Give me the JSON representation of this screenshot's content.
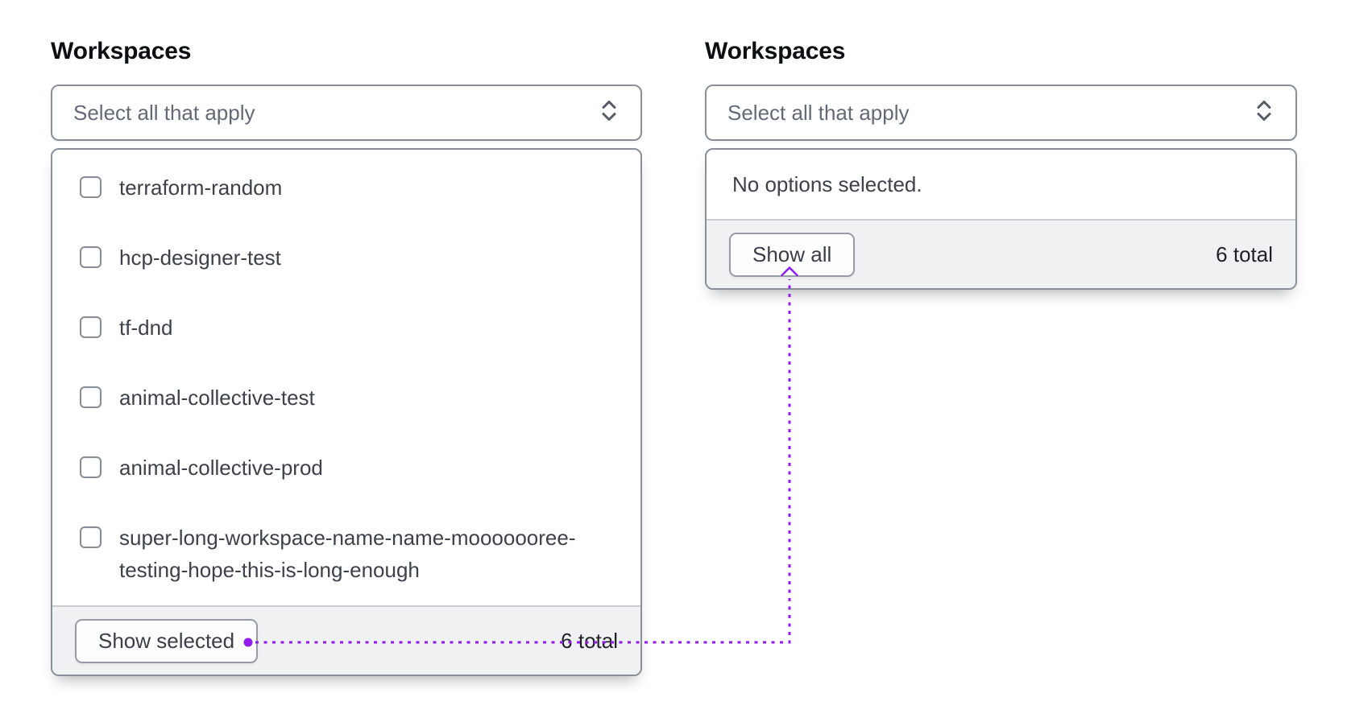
{
  "left_select": {
    "label": "Workspaces",
    "placeholder": "Select all that apply",
    "options": [
      "terraform-random",
      "hcp-designer-test",
      "tf-dnd",
      "animal-collective-test",
      "animal-collective-prod",
      "super-long-workspace-name-name-mooooooree-testing-hope-this-is-long-enough"
    ],
    "footer": {
      "button_label": "Show selected",
      "total": "6 total"
    }
  },
  "right_select": {
    "label": "Workspaces",
    "placeholder": "Select all that apply",
    "empty_text": "No options selected.",
    "footer": {
      "button_label": "Show all",
      "total": "6 total"
    }
  },
  "annotation": {
    "color": "#911ced"
  },
  "colors": {
    "border": "#8a909a",
    "footer_bg": "#f0f1f2",
    "text": "#3d414a",
    "placeholder_text": "#636a76"
  }
}
